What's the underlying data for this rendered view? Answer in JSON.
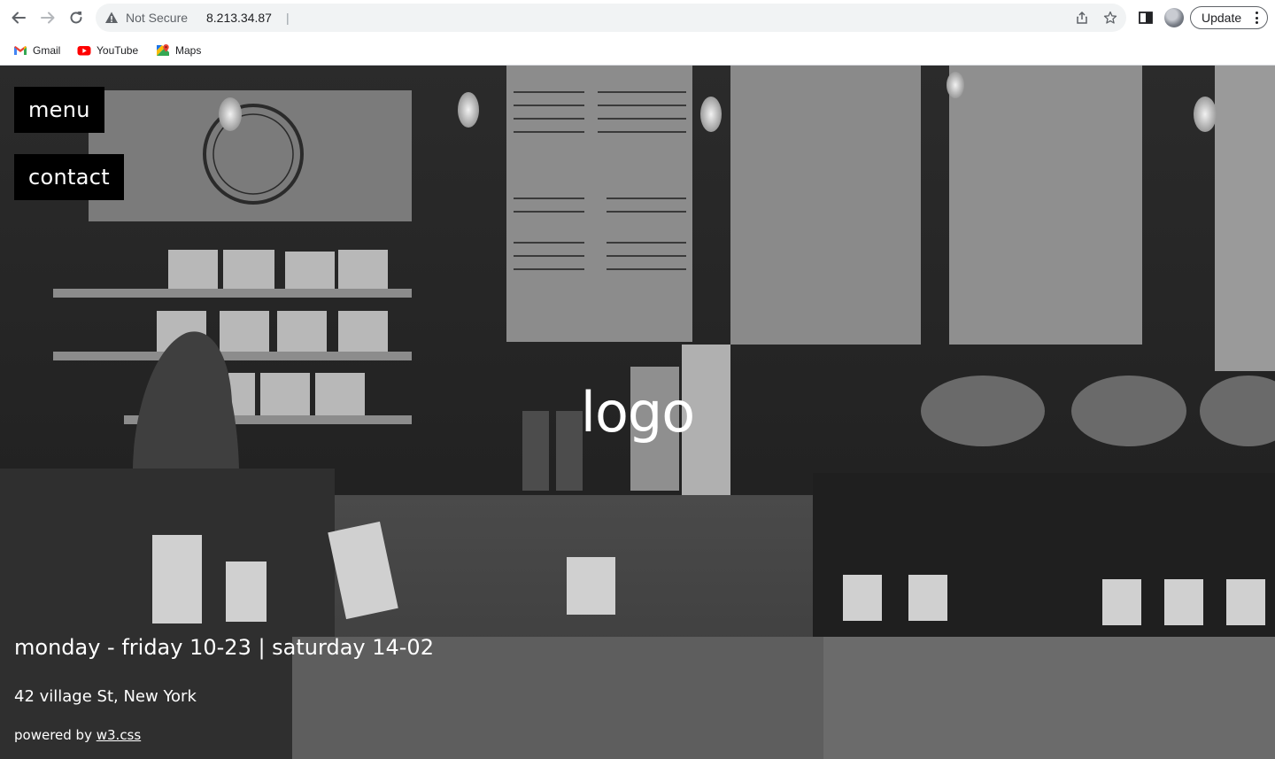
{
  "browser": {
    "security_label": "Not Secure",
    "separator": "|",
    "url": "8.213.34.87",
    "update_label": "Update",
    "icons": [
      "back-arrow-icon",
      "forward-arrow-icon",
      "reload-icon",
      "warning-icon",
      "share-icon",
      "star-icon",
      "side-panel-icon",
      "profile-avatar",
      "more-vert-icon"
    ],
    "bookmarks": [
      {
        "label": "Gmail",
        "icon": "gmail-icon"
      },
      {
        "label": "YouTube",
        "icon": "youtube-icon"
      },
      {
        "label": "Maps",
        "icon": "maps-icon"
      }
    ]
  },
  "page": {
    "nav": {
      "menu_label": "menu",
      "contact_label": "contact"
    },
    "logo_text": "logo",
    "hours": "monday - friday 10-23 | saturday 14-02",
    "address": "42 village St, New York",
    "powered_prefix": "powered by",
    "powered_link": "w3.css"
  },
  "colors": {
    "nav_button_bg": "#000000",
    "text": "#ffffff",
    "omnibox_bg": "#f1f3f4"
  }
}
